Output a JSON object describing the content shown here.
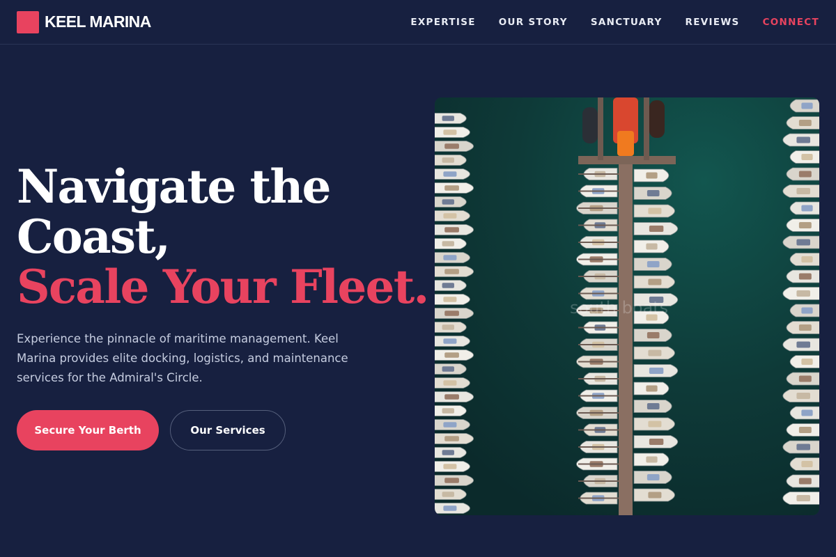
{
  "brand": {
    "name": "KEEL MARINA",
    "mark_color": "#e8435f"
  },
  "nav": {
    "items": [
      {
        "label": "EXPERTISE"
      },
      {
        "label": "OUR STORY"
      },
      {
        "label": "SANCTUARY"
      },
      {
        "label": "REVIEWS"
      },
      {
        "label": "CONNECT"
      }
    ]
  },
  "hero": {
    "title_line1": "Navigate the",
    "title_line2": "Coast,",
    "title_accent": "Scale Your Fleet.",
    "description": "Experience the pinnacle of maritime management. Keel Marina provides elite docking, logistics, and maintenance services for the Admiral's Circle.",
    "primary_button": "Secure Your Berth",
    "secondary_button": "Our Services",
    "image_watermark": "south boats"
  },
  "colors": {
    "background": "#172040",
    "accent": "#e8435f",
    "text": "#ffffff",
    "muted_text": "#c6cde0",
    "water": "#0f3c3a"
  },
  "icons": {
    "brand_mark": "square-logo-icon",
    "hero_image": "aerial-marina-photo"
  }
}
